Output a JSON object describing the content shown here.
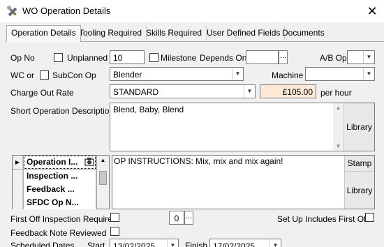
{
  "window": {
    "title": "WO Operation Details",
    "close_glyph": "✕"
  },
  "tabs": [
    {
      "label": "Operation Details",
      "active": true
    },
    {
      "label": "Tooling Required",
      "active": false
    },
    {
      "label": "Skills Required",
      "active": false
    },
    {
      "label": "User Defined Fields",
      "active": false
    },
    {
      "label": "Documents",
      "active": false
    }
  ],
  "form": {
    "op_no_label": "Op No",
    "unplanned_label": "Unplanned",
    "unplanned_checked": false,
    "op_no_value": "10",
    "milestone_label": "Milestone",
    "milestone_checked": false,
    "depends_on_label": "Depends On",
    "depends_on_value": "",
    "ab_op_label": "A/B Op",
    "ab_op_value": "",
    "wc_or_label": "WC or",
    "subcon_label": "SubCon Op",
    "subcon_checked": false,
    "work_centre_value": "Blender",
    "machine_label": "Machine",
    "machine_value": "",
    "charge_label": "Charge Out Rate",
    "charge_value": "STANDARD",
    "rate_value": "£105.00",
    "rate_unit": "per hour",
    "short_desc_label": "Short Operation Description",
    "short_desc_value": "Blend, Baby, Blend",
    "library_label": "Library",
    "instructions_value": "OP INSTRUCTIONS: Mix, mix and mix again!",
    "stamp_label": "Stamp",
    "library2_label": "Library",
    "first_off_label": "First Off Inspection Required",
    "first_off_checked": false,
    "first_off_qty": "0",
    "setup_label": "Set Up Includes First Off",
    "setup_checked": false,
    "feedback_label": "Feedback Note Reviewed",
    "feedback_checked": false,
    "scheduled_label": "Scheduled Dates",
    "start_label": "Start",
    "start_value": "13/02/2025",
    "finish_label": "Finish",
    "finish_value": "17/02/2025",
    "ellipsis": "..."
  },
  "note_grid": {
    "rows": [
      {
        "label": "Operation I...",
        "selected": true
      },
      {
        "label": "Inspection ...",
        "selected": false
      },
      {
        "label": "Feedback ...",
        "selected": false
      },
      {
        "label": "SFDC Op N...",
        "selected": false
      }
    ],
    "current_row_glyph": "▶"
  },
  "icons": {
    "app": "tools-icon",
    "notes": "notes-icon",
    "dropdown": "chevron-down-icon",
    "scroll_up": "arrow-up-icon",
    "scroll_down": "arrow-down-icon"
  },
  "colors": {
    "rate_field_bg": "#fbe9d6"
  }
}
